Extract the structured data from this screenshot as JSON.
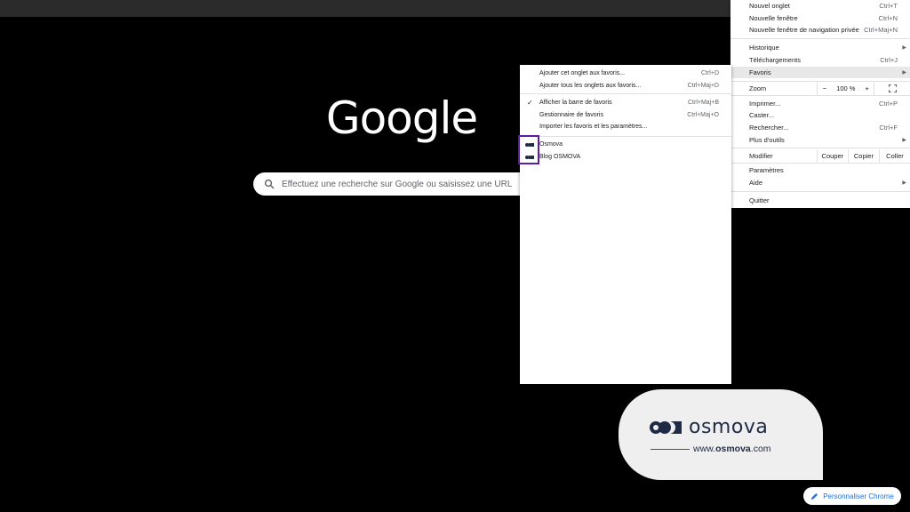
{
  "newtab": {
    "logo_text": "Google",
    "search_placeholder": "Effectuez une recherche sur Google ou saisissez une URL",
    "customize_label": "Personnaliser Chrome"
  },
  "menu": {
    "new_tab": {
      "label": "Nouvel onglet",
      "shortcut": "Ctrl+T"
    },
    "new_window": {
      "label": "Nouvelle fenêtre",
      "shortcut": "Ctrl+N"
    },
    "incognito": {
      "label": "Nouvelle fenêtre de navigation privée",
      "shortcut": "Ctrl+Maj+N"
    },
    "history": {
      "label": "Historique"
    },
    "downloads": {
      "label": "Téléchargements",
      "shortcut": "Ctrl+J"
    },
    "bookmarks": {
      "label": "Favoris"
    },
    "zoom": {
      "label": "Zoom",
      "minus": "−",
      "value": "100 %",
      "plus": "+"
    },
    "print": {
      "label": "Imprimer...",
      "shortcut": "Ctrl+P"
    },
    "cast": {
      "label": "Caster..."
    },
    "find": {
      "label": "Rechercher...",
      "shortcut": "Ctrl+F"
    },
    "more_tools": {
      "label": "Plus d'outils"
    },
    "edit": {
      "label": "Modifier",
      "cut": "Couper",
      "copy": "Copier",
      "paste": "Coller"
    },
    "settings": {
      "label": "Paramètres"
    },
    "help": {
      "label": "Aide"
    },
    "quit": {
      "label": "Quitter"
    }
  },
  "submenu": {
    "bookmark_tab": {
      "label": "Ajouter cet onglet aux favoris...",
      "shortcut": "Ctrl+D"
    },
    "bookmark_all": {
      "label": "Ajouter tous les onglets aux favoris...",
      "shortcut": "Ctrl+Maj+D"
    },
    "show_bar": {
      "label": "Afficher la barre de favoris",
      "shortcut": "Ctrl+Maj+B",
      "check": "✓"
    },
    "manager": {
      "label": "Gestionnaire de favoris",
      "shortcut": "Ctrl+Maj+O"
    },
    "import": {
      "label": "Importer les favoris et les paramètres..."
    },
    "bookmarks": [
      {
        "label": "Osmova"
      },
      {
        "label": "Blog OSMOVA"
      }
    ]
  },
  "overlay": {
    "brand": "osmova",
    "url_prefix": "www.",
    "url_bold": "osmova",
    "url_suffix": ".com"
  },
  "colors": {
    "highlight": "#5b1f9e",
    "brand_dark": "#1f2a44",
    "link_blue": "#1a73e8"
  }
}
